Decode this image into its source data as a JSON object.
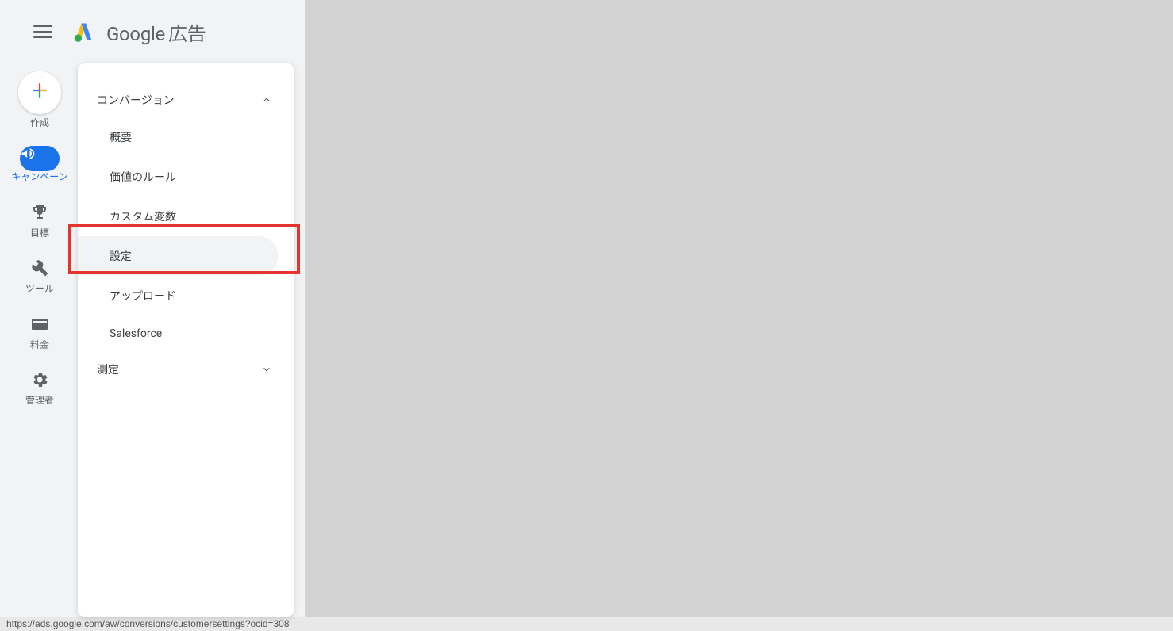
{
  "header": {
    "product_name_google": "Google",
    "product_name_ads": "広告"
  },
  "rail": {
    "create": "作成",
    "campaign": "キャンペーン",
    "goals": "目標",
    "tools": "ツール",
    "billing": "料金",
    "admin": "管理者"
  },
  "panel": {
    "section_conversion": "コンバージョン",
    "items": {
      "overview": "概要",
      "value_rules": "価値のルール",
      "custom_vars": "カスタム変数",
      "settings": "設定",
      "upload": "アップロード",
      "salesforce": "Salesforce"
    },
    "section_measurement": "測定"
  },
  "status_url": "https://ads.google.com/aw/conversions/customersettings?ocid=308"
}
